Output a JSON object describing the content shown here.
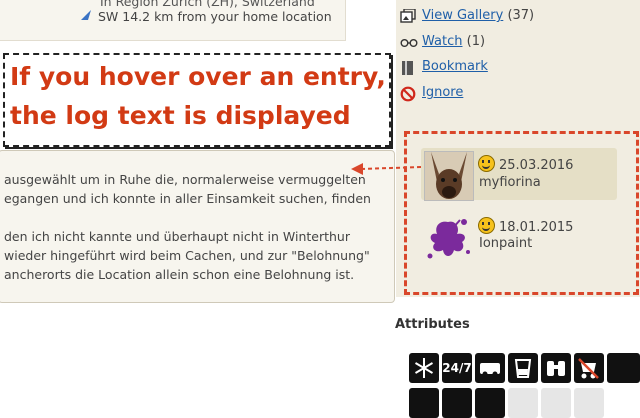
{
  "location": {
    "region": "In Region Zürich (ZH), Switzerland",
    "distance": "SW 14.2 km from your home location"
  },
  "callout": {
    "line1": "If you hover over an entry,",
    "line2": "the log text is displayed"
  },
  "log_text": {
    "lines": [
      "ausgewählt um in Ruhe die, normalerweise vermuggelten",
      "egangen und ich konnte in aller Einsamkeit suchen, finden",
      "",
      "den ich nicht kannte und überhaupt nicht in Winterthur",
      "wieder hingeführt wird beim Cachen, und zur \"Belohnung\"",
      "ancherorts die Location allein schon eine Belohnung ist."
    ]
  },
  "sidebar": {
    "links": [
      {
        "label": "View Gallery",
        "count": "(37)",
        "icon": "gallery-icon"
      },
      {
        "label": "Watch",
        "count": "(1)",
        "icon": "glasses-icon"
      },
      {
        "label": "Bookmark",
        "count": "",
        "icon": "bookmark-icon"
      },
      {
        "label": "Ignore",
        "count": "",
        "icon": "ignore-icon"
      }
    ]
  },
  "logs": [
    {
      "date": "25.03.2016",
      "user": "myfiorina",
      "type": "found-smiley-icon"
    },
    {
      "date": "18.01.2015",
      "user": "Ionpaint",
      "type": "found-smiley-icon"
    }
  ],
  "attributes": {
    "title": "Attributes",
    "row1": [
      "snowflake-icon",
      "24-7-icon",
      "car-icon",
      "water-icon",
      "binoculars-icon",
      "stroller-icon"
    ],
    "label_247": "24/7"
  },
  "colors": {
    "callout_text": "#d23a14",
    "highlight_border": "#d9472b",
    "link": "#1f5fa8"
  }
}
